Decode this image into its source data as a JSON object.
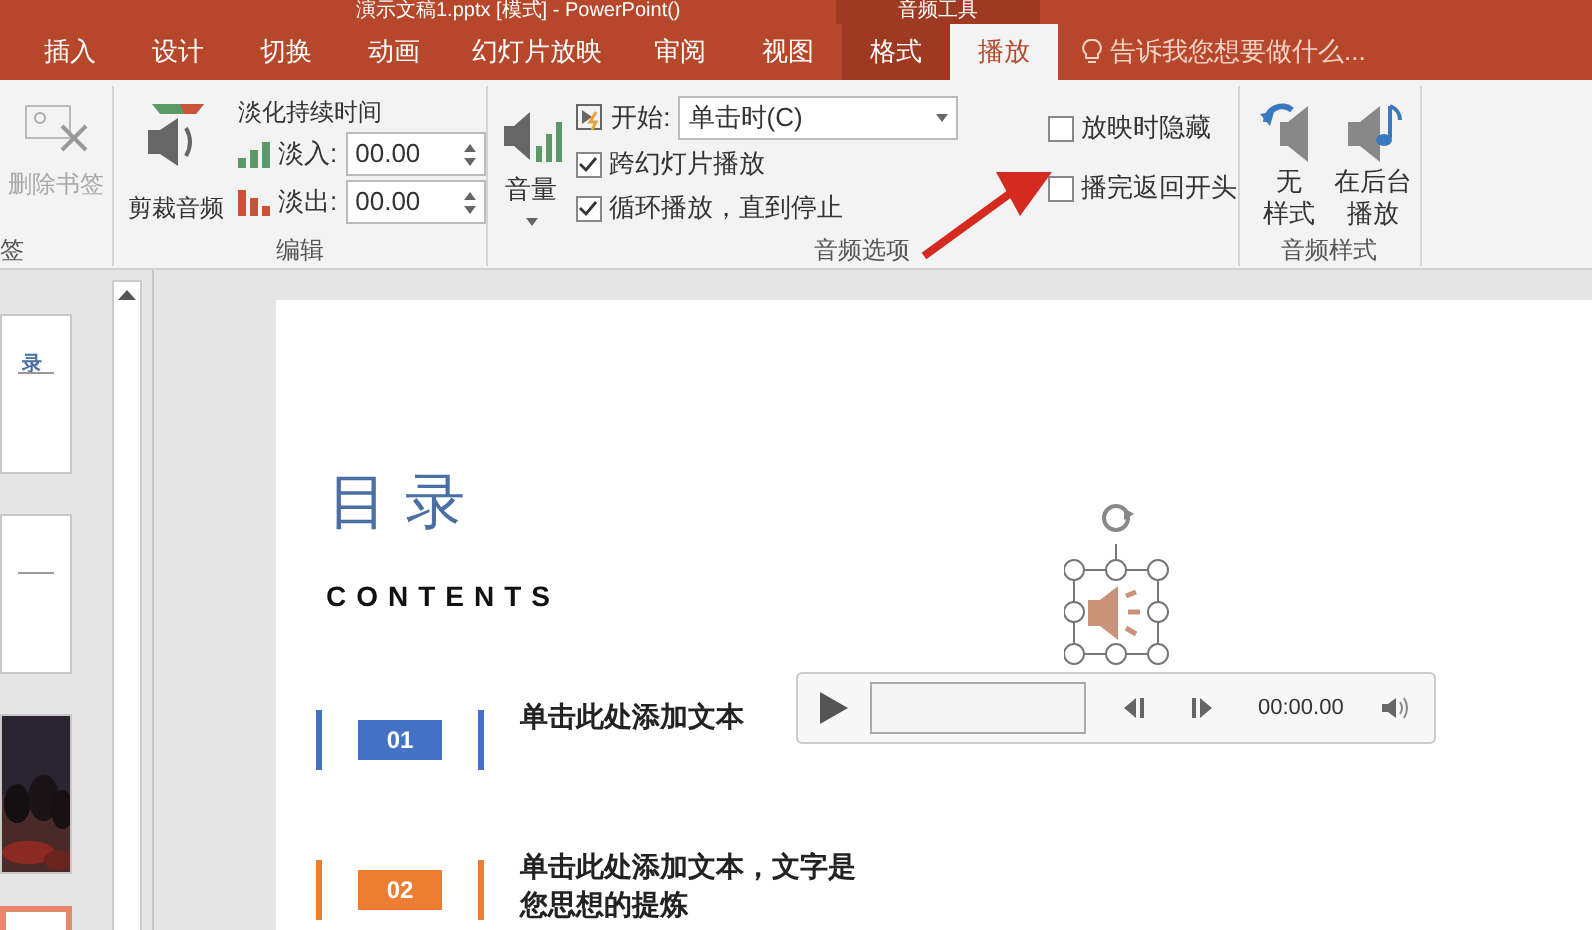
{
  "window": {
    "title": "演示文稿1.pptx [模式] - PowerPoint()",
    "context_group": "音频工具"
  },
  "tabs": [
    {
      "label": "插入",
      "selected": false,
      "contextual": false
    },
    {
      "label": "设计",
      "selected": false,
      "contextual": false
    },
    {
      "label": "切换",
      "selected": false,
      "contextual": false
    },
    {
      "label": "动画",
      "selected": false,
      "contextual": false
    },
    {
      "label": "幻灯片放映",
      "selected": false,
      "contextual": false
    },
    {
      "label": "审阅",
      "selected": false,
      "contextual": false
    },
    {
      "label": "视图",
      "selected": false,
      "contextual": false
    },
    {
      "label": "格式",
      "selected": false,
      "contextual": true
    },
    {
      "label": "播放",
      "selected": true,
      "contextual": true
    }
  ],
  "tell_me": {
    "placeholder": "告诉我您想要做什么..."
  },
  "ribbon": {
    "bookmarks": {
      "label": "签",
      "remove": {
        "label": "删除书签",
        "disabled": true
      }
    },
    "editing": {
      "label": "编辑",
      "trim": "剪裁音频",
      "fade_title": "淡化持续时间",
      "fade_in": {
        "label": "淡入:",
        "value": "00.00"
      },
      "fade_out": {
        "label": "淡出:",
        "value": "00.00"
      }
    },
    "audio_options": {
      "label": "音频选项",
      "volume": "音量",
      "start": {
        "label": "开始:",
        "value": "单击时(C)"
      },
      "checkboxes": [
        {
          "label": "跨幻灯片播放",
          "checked": true
        },
        {
          "label": "循环播放，直到停止",
          "checked": true
        },
        {
          "label": "放映时隐藏",
          "checked": false
        },
        {
          "label": "播完返回开头",
          "checked": false
        }
      ]
    },
    "audio_styles": {
      "label": "音频样式",
      "buttons": [
        {
          "lines": [
            "无",
            "样式"
          ]
        },
        {
          "lines": [
            "在后台",
            "播放"
          ]
        }
      ]
    }
  },
  "thumbnails": [
    {
      "kind": "text",
      "text": "录",
      "selected": false
    },
    {
      "kind": "text",
      "selected": false
    },
    {
      "kind": "picture",
      "selected": false
    },
    {
      "kind": "text",
      "selected": true
    }
  ],
  "slide": {
    "title": "目 录",
    "subtitle": "CONTENTS",
    "items": [
      {
        "number": "01",
        "color": "#4472c4",
        "lines": [
          "单击此处添加文本"
        ]
      },
      {
        "number": "02",
        "color": "#ed7d31",
        "lines": [
          "单击此处添加文本，文字是",
          "您思想的提炼"
        ]
      }
    ],
    "player": {
      "time": "00:00.00"
    }
  }
}
